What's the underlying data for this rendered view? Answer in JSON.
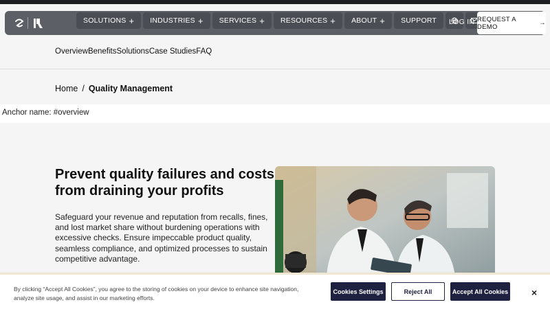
{
  "nav": {
    "menu": [
      {
        "label": "SOLUTIONS",
        "plus": "+"
      },
      {
        "label": "INDUSTRIES",
        "plus": "+"
      },
      {
        "label": "SERVICES",
        "plus": "+"
      },
      {
        "label": "RESOURCES",
        "plus": "+"
      },
      {
        "label": "ABOUT",
        "plus": "+"
      },
      {
        "label": "SUPPORT",
        "plus": ""
      }
    ],
    "globe_icon": "globe-icon",
    "mail_icon": "mail-icon",
    "login": "LOG IN",
    "demo": "REQUEST A DEMO",
    "demo_arrow": "→"
  },
  "tabs": [
    "Overview",
    "Benefits",
    "Solutions",
    "Case Studies",
    "FAQ"
  ],
  "breadcrumb": {
    "home": "Home",
    "sep": "/",
    "current": "Quality Management"
  },
  "anchor": "Anchor name: #overview",
  "hero": {
    "title": "Prevent quality failures and costs from draining your profits",
    "body": "Safeguard your revenue and reputation from recalls, fines, and lost market share without burdening operations with excessive checks. Ensure impeccable product quality, seamless compliance, and optimized processes to sustain competitive advantage."
  },
  "cookie": {
    "text": "By clicking “Accept All Cookies”, you agree to the storing of cookies on your device to enhance site navigation, analyze site usage, and assist in our marketing efforts.",
    "settings": "Cookies Settings",
    "reject": "Reject All",
    "accept": "Accept All Cookies",
    "close": "×"
  },
  "colors": {
    "navbar": "#5c5f66",
    "menu_item": "#4a4d53",
    "cookie_button": "#1e2140",
    "page_bg": "#f5f5f5"
  }
}
